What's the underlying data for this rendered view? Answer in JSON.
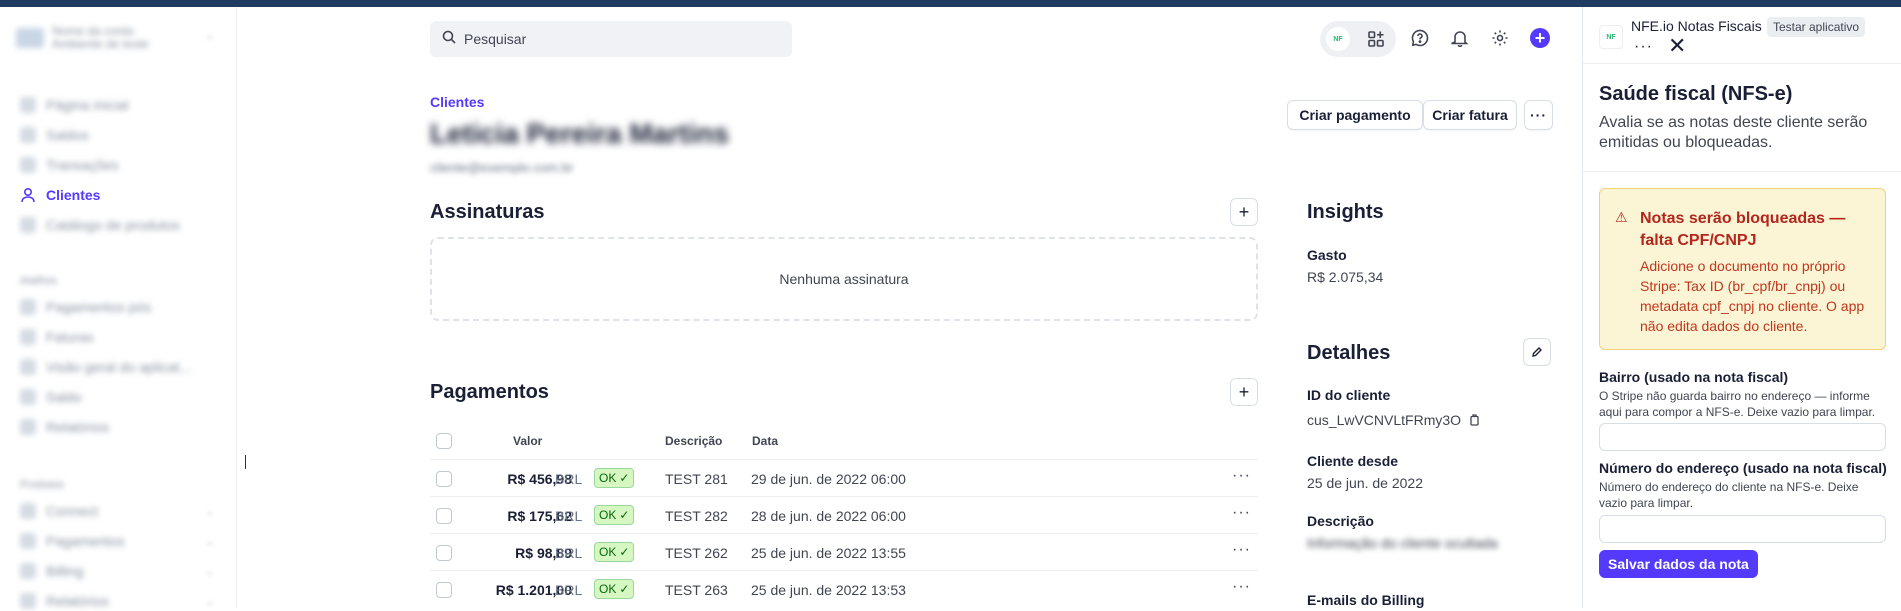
{
  "sidebar": {
    "account_name": "Nome da conta",
    "account_sub": "Ambiente de teste",
    "items_top": [
      {
        "label": "Página inicial",
        "active": false
      },
      {
        "label": "Saldos",
        "active": false
      },
      {
        "label": "Transações",
        "active": false
      },
      {
        "label": "Clientes",
        "active": true
      },
      {
        "label": "Catálogo de produtos",
        "active": false
      }
    ],
    "section_shortcuts": "Atalhos",
    "items_shortcuts": [
      "Pagamentos pós",
      "Faturas",
      "Visão geral do aplicat...",
      "Saldo",
      "Relatórios"
    ],
    "section_products": "Produtos",
    "items_products": [
      "Connect",
      "Pagamentos",
      "Billing",
      "Relatórios"
    ]
  },
  "header": {
    "search_placeholder": "Pesquisar",
    "app_pill_logo": "NF"
  },
  "customer": {
    "breadcrumb": "Clientes",
    "name": "Leticia Pereira Martins",
    "email": "cliente@exemplo.com.br",
    "actions": {
      "create_payment": "Criar pagamento",
      "create_invoice": "Criar fatura",
      "more": "···"
    }
  },
  "subscriptions": {
    "title": "Assinaturas",
    "empty": "Nenhuma assinatura"
  },
  "payments": {
    "title": "Pagamentos",
    "columns": {
      "amount": "Valor",
      "description": "Descrição",
      "date": "Data"
    },
    "rows": [
      {
        "amount": "R$ 456,98",
        "currency": "BRL",
        "status": "OK",
        "description": "TEST 281",
        "date": "29 de jun. de 2022 06:00"
      },
      {
        "amount": "R$ 175,62",
        "currency": "BRL",
        "status": "OK",
        "description": "TEST 282",
        "date": "28 de jun. de 2022 06:00"
      },
      {
        "amount": "R$ 98,89",
        "currency": "BRL",
        "status": "OK",
        "description": "TEST 262",
        "date": "25 de jun. de 2022 13:55"
      },
      {
        "amount": "R$ 1.201,00",
        "currency": "BRL",
        "status": "OK",
        "description": "TEST 263",
        "date": "25 de jun. de 2022 13:53"
      }
    ]
  },
  "insights": {
    "title": "Insights",
    "spent_label": "Gasto",
    "spent_value": "R$ 2.075,34"
  },
  "details": {
    "title": "Detalhes",
    "id_label": "ID do cliente",
    "id_value": "cus_LwVCNVLtFRmy3O",
    "since_label": "Cliente desde",
    "since_value": "25 de jun. de 2022",
    "desc_label": "Descrição",
    "desc_value": "Informação do cliente ocultada",
    "billing_label": "E-mails do Billing"
  },
  "panel": {
    "app_logo": "NF",
    "app_name": "NFE.io Notas Fiscais",
    "test_badge": "Testar aplicativo",
    "title": "Saúde fiscal (NFS-e)",
    "subtitle": "Avalia se as notas deste cliente serão emitidas ou bloqueadas.",
    "alert": {
      "title": "Notas serão bloqueadas — falta CPF/CNPJ",
      "body": "Adicione o documento no próprio Stripe: Tax ID (br_cpf/br_cnpj) ou metadata cpf_cnpj no cliente. O app não edita dados do cliente."
    },
    "bairro_label": "Bairro (usado na nota fiscal)",
    "bairro_help": "O Stripe não guarda bairro no endereço — informe aqui para compor a NFS-e. Deixe vazio para limpar.",
    "bairro_value": "",
    "numero_label": "Número do endereço (usado na nota fiscal)",
    "numero_help": "Número do endereço do cliente na NFS-e. Deixe vazio para limpar.",
    "numero_value": "",
    "save_label": "Salvar dados da nota"
  },
  "colors": {
    "accent": "#533afd",
    "topbar": "#1f3b5f",
    "alert_bg": "#fcf5d5",
    "alert_text": "#b3261e",
    "ok_bg": "#d7f7c2"
  }
}
